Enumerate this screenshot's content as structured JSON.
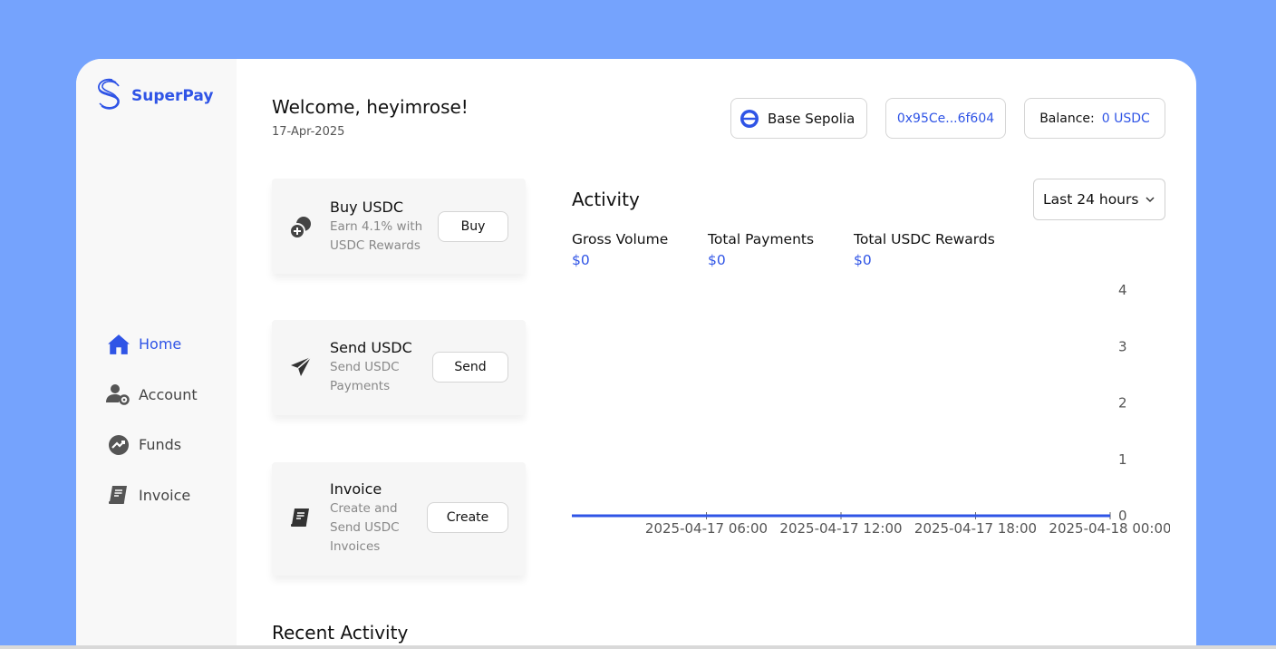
{
  "brand": {
    "name": "SuperPay",
    "accent": "#2f54e6"
  },
  "header": {
    "welcome": "Welcome, heyimrose!",
    "date": "17-Apr-2025",
    "network": {
      "label": "Base Sepolia",
      "icon": "base-network-icon"
    },
    "wallet": "0x95Ce...6f604",
    "balance_label": "Balance:",
    "balance_value": "0 USDC"
  },
  "sidebar": {
    "items": [
      {
        "label": "Home",
        "icon": "home-icon",
        "active": true
      },
      {
        "label": "Account",
        "icon": "account-settings-icon"
      },
      {
        "label": "Funds",
        "icon": "funds-trend-icon"
      },
      {
        "label": "Invoice",
        "icon": "invoice-icon"
      }
    ]
  },
  "cards": [
    {
      "title": "Buy USDC",
      "desc": "Earn 4.1% with USDC Rewards",
      "button": "Buy",
      "icon": "coins-icon"
    },
    {
      "title": "Send USDC",
      "desc": "Send USDC Payments",
      "button": "Send",
      "icon": "paper-plane-icon"
    },
    {
      "title": "Invoice",
      "desc": "Create and Send USDC Invoices",
      "button": "Create",
      "icon": "invoice-icon"
    }
  ],
  "activity": {
    "title": "Activity",
    "range": "Last 24 hours",
    "stats": [
      {
        "label": "Gross Volume",
        "value": "$0"
      },
      {
        "label": "Total Payments",
        "value": "$0"
      },
      {
        "label": "Total USDC Rewards",
        "value": "$0"
      }
    ]
  },
  "chart_data": {
    "type": "line",
    "x": [
      "2025-04-17 00:00",
      "2025-04-18 00:00"
    ],
    "values": [
      0,
      0
    ],
    "x_ticks": [
      "2025-04-17 06:00",
      "2025-04-17 12:00",
      "2025-04-17 18:00",
      "2025-04-18 00:00"
    ],
    "y_ticks": [
      0,
      1,
      2,
      3,
      4
    ],
    "ylim": [
      0,
      4
    ],
    "line_color": "#2f54e6",
    "grid": false,
    "y_axis_side": "right"
  },
  "recent": {
    "title": "Recent Activity"
  }
}
